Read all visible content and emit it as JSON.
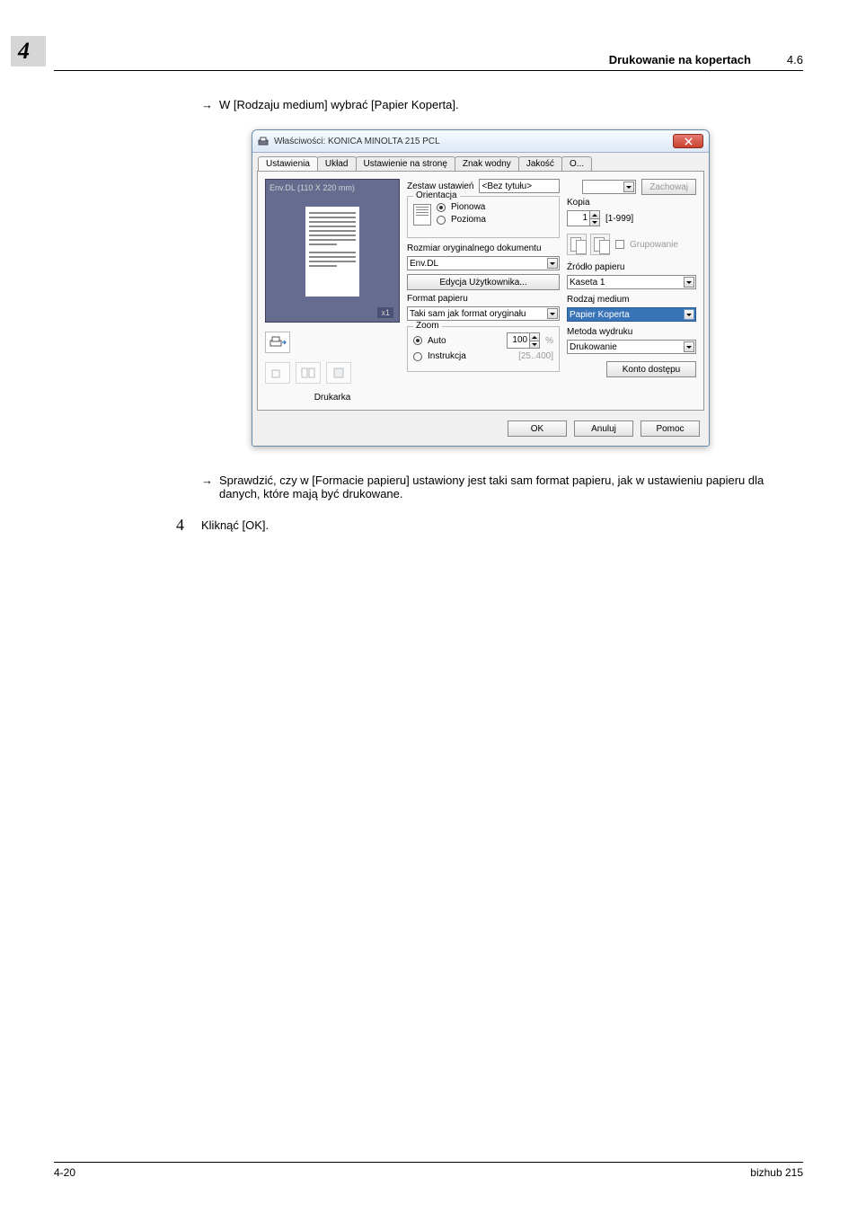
{
  "header": {
    "chapter": "4",
    "title": "Drukowanie na kopertach",
    "section": "4.6"
  },
  "body": {
    "arrow1": "W [Rodzaju medium] wybrać [Papier Koperta].",
    "arrow2": "Sprawdzić, czy w [Formacie papieru] ustawiony jest taki sam format papieru, jak w ustawieniu papieru dla danych, które mają być drukowane.",
    "step4_num": "4",
    "step4_text": "Kliknąć [OK]."
  },
  "footer": {
    "left": "4-20",
    "right": "bizhub 215"
  },
  "dialog": {
    "title": "Właściwości: KONICA MINOLTA 215 PCL",
    "tabs": [
      "Ustawienia",
      "Układ",
      "Ustawienie na stronę",
      "Znak wodny",
      "Jakość",
      "O..."
    ],
    "preview_label": "Env.DL  (110 X 220 mm)",
    "preview_scale": "x1",
    "printer_label": "Drukarka",
    "settings_label": "Zestaw ustawień",
    "settings_value": "<Bez tytułu>",
    "save_btn": "Zachowaj",
    "orientation_legend": "Orientacja",
    "orient_portrait": "Pionowa",
    "orient_landscape": "Pozioma",
    "orig_size_label": "Rozmiar oryginalnego dokumentu",
    "orig_size_value": "Env.DL",
    "user_edit_btn": "Edycja Użytkownika...",
    "paper_format_label": "Format papieru",
    "paper_format_value": "Taki sam jak format oryginału",
    "zoom_legend": "Zoom",
    "zoom_auto": "Auto",
    "zoom_manual": "Instrukcja",
    "zoom_value": "100",
    "zoom_pct": "%",
    "zoom_range": "[25..400]",
    "copies_label": "Kopia",
    "copies_value": "1",
    "copies_range": "[1-999]",
    "collate_label": "Grupowanie",
    "source_label": "Źródło papieru",
    "source_value": "Kaseta 1",
    "media_label": "Rodzaj medium",
    "media_value": "Papier Koperta",
    "method_label": "Metoda wydruku",
    "method_value": "Drukowanie",
    "account_btn": "Konto dostępu",
    "ok": "OK",
    "cancel": "Anuluj",
    "help": "Pomoc"
  }
}
